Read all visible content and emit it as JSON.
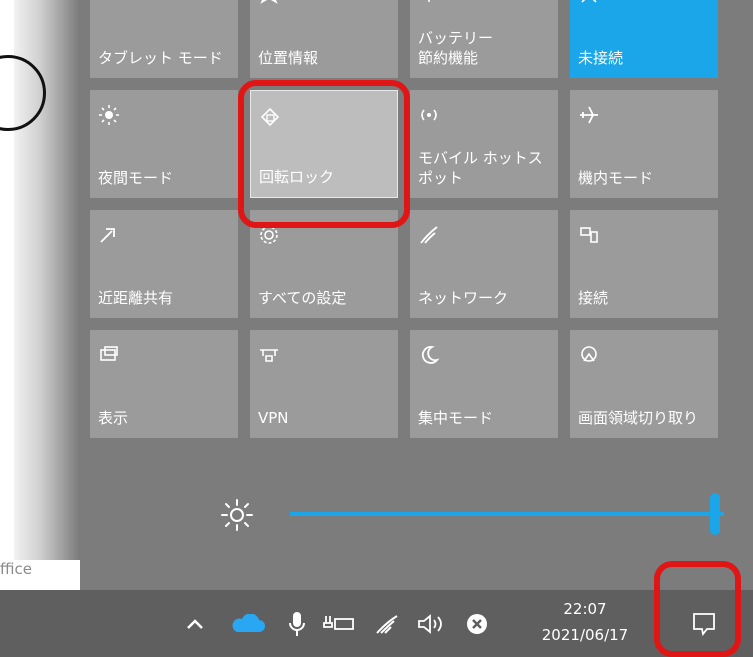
{
  "background": {
    "fragment_text": "ffice"
  },
  "tiles": [
    {
      "id": "tablet-mode",
      "label": "タブレット モード",
      "icon": "tablet-mode-icon",
      "state": "off"
    },
    {
      "id": "location",
      "label": "位置情報",
      "icon": "location-icon",
      "state": "off"
    },
    {
      "id": "battery-saver",
      "label": "バッテリー\n節約機能",
      "icon": "battery-saver-icon",
      "state": "off"
    },
    {
      "id": "vpn-top",
      "label": "未接続",
      "icon": "network-icon",
      "state": "active"
    },
    {
      "id": "night-light",
      "label": "夜間モード",
      "icon": "night-light-icon",
      "state": "off"
    },
    {
      "id": "rotation-lock",
      "label": "回転ロック",
      "icon": "rotation-lock-icon",
      "state": "pressed"
    },
    {
      "id": "mobile-hotspot",
      "label": "モバイル ホットスポット",
      "icon": "mobile-hotspot-icon",
      "state": "off"
    },
    {
      "id": "airplane-mode",
      "label": "機内モード",
      "icon": "airplane-icon",
      "state": "off"
    },
    {
      "id": "nearby-share",
      "label": "近距離共有",
      "icon": "nearby-share-icon",
      "state": "off"
    },
    {
      "id": "all-settings",
      "label": "すべての設定",
      "icon": "gear-icon",
      "state": "off"
    },
    {
      "id": "network",
      "label": "ネットワーク",
      "icon": "wifi-icon",
      "state": "off"
    },
    {
      "id": "connect",
      "label": "接続",
      "icon": "connect-icon",
      "state": "off"
    },
    {
      "id": "project",
      "label": "表示",
      "icon": "project-icon",
      "state": "off"
    },
    {
      "id": "vpn",
      "label": "VPN",
      "icon": "vpn-icon",
      "state": "off"
    },
    {
      "id": "focus-assist",
      "label": "集中モード",
      "icon": "moon-icon",
      "state": "off"
    },
    {
      "id": "snip",
      "label": "画面領域切り取り",
      "icon": "snip-icon",
      "state": "off"
    }
  ],
  "brightness": {
    "icon": "sun-icon",
    "value": 100
  },
  "taskbar": {
    "time": "22:07",
    "date": "2021/06/17",
    "tray_icons": [
      "chevron-up-icon",
      "onedrive-cloud-icon",
      "microphone-icon",
      "battery-plug-icon",
      "wifi-signal-icon",
      "volume-icon",
      "close-circle-icon"
    ],
    "notification_icon": "notification-icon"
  },
  "colors": {
    "accent": "#1aa6e8",
    "tile": "#9b9b9b",
    "panel": "#7c7c7c",
    "taskbar": "#5f5f5f",
    "highlight": "#e01515"
  }
}
